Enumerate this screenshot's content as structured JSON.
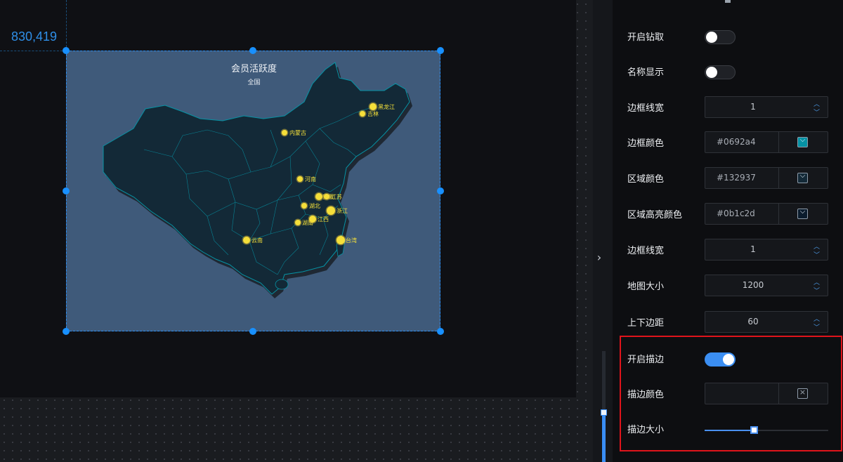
{
  "canvas": {
    "coordinate_readout": "830,419"
  },
  "map": {
    "title": "会员活跃度",
    "subtitle": "全国",
    "markers": [
      {
        "name": "黑龙江"
      },
      {
        "name": "吉林"
      },
      {
        "name": "内蒙古"
      },
      {
        "name": "河南"
      },
      {
        "name": "安徽"
      },
      {
        "name": "江苏"
      },
      {
        "name": "湖北"
      },
      {
        "name": "浙江"
      },
      {
        "name": "湖南"
      },
      {
        "name": "江西"
      },
      {
        "name": "云南"
      },
      {
        "name": "台湾"
      }
    ],
    "colors": {
      "background": "#3f5a7a",
      "region": "#132937",
      "border": "#0692a4",
      "marker": "#f4e03a"
    }
  },
  "panel": {
    "rows": [
      {
        "label": "开启钻取",
        "type": "toggle",
        "on": false
      },
      {
        "label": "名称显示",
        "type": "toggle",
        "on": false
      },
      {
        "label": "边框线宽",
        "type": "number",
        "value": "1"
      },
      {
        "label": "边框颜色",
        "type": "color",
        "value": "#0692a4",
        "swatch": "#0692a4"
      },
      {
        "label": "区域颜色",
        "type": "color",
        "value": "#132937",
        "swatch": "#132937"
      },
      {
        "label": "区域高亮颜色",
        "type": "color",
        "value": "#0b1c2d",
        "swatch": "#0b1c2d"
      },
      {
        "label": "边框线宽",
        "type": "number",
        "value": "1"
      },
      {
        "label": "地图大小",
        "type": "number",
        "value": "1200"
      },
      {
        "label": "上下边距",
        "type": "number",
        "value": "60"
      },
      {
        "label": "开启描边",
        "type": "toggle",
        "on": true
      },
      {
        "label": "描边颜色",
        "type": "color",
        "value": "",
        "swatch": "none"
      },
      {
        "label": "描边大小",
        "type": "slider",
        "fraction": 0.4
      }
    ],
    "icons": {
      "collapse": "chevron-right-icon",
      "spinner_up": "caret-up-icon",
      "spinner_down": "caret-down-icon",
      "color_dropdown": "chevron-down-icon",
      "color_clear": "clear-color-icon"
    },
    "accent_color": "#3b8ef2",
    "highlight_color": "#e0141b"
  }
}
